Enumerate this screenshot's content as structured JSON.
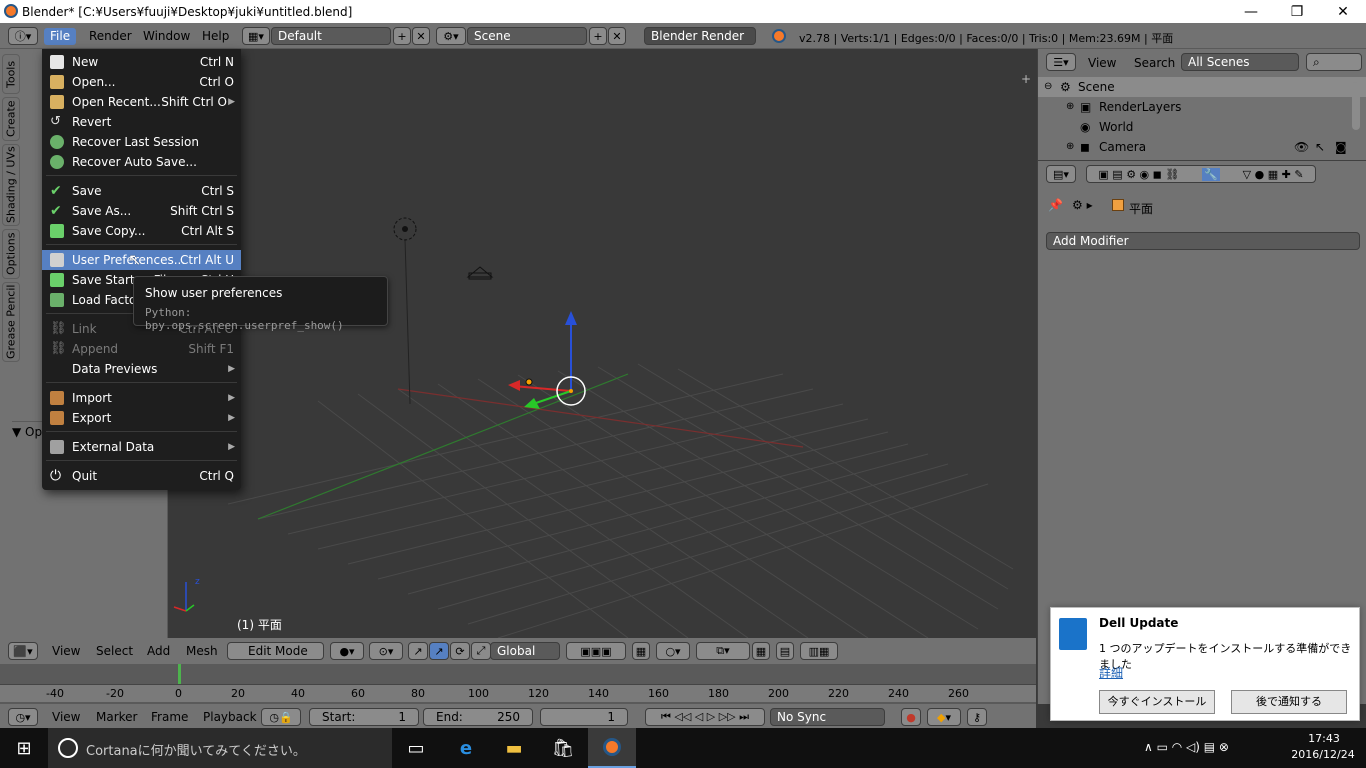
{
  "window": {
    "title": "Blender* [C:¥Users¥fuuji¥Desktop¥juki¥untitled.blend]",
    "minimize": "—",
    "restore": "❐",
    "close": "✕"
  },
  "infobar": {
    "menus": [
      "File",
      "Render",
      "Window",
      "Help"
    ],
    "screen_layout": "Default",
    "scene": "Scene",
    "engine": "Blender Render",
    "stats": "v2.78 | Verts:1/1 | Edges:0/0 | Faces:0/0 | Tris:0 | Mem:23.69M | 平面"
  },
  "tool_tabs": [
    "Tools",
    "Create",
    "Shading / UVs",
    "Options",
    "Grease Pencil"
  ],
  "tool_panel": {
    "operator_label": "Op"
  },
  "file_menu": {
    "items": [
      {
        "label": "New",
        "shortcut": "Ctrl N"
      },
      {
        "label": "Open...",
        "shortcut": "Ctrl O"
      },
      {
        "label": "Open Recent...",
        "shortcut": "Shift Ctrl O"
      },
      {
        "label": "Revert",
        "shortcut": ""
      },
      {
        "label": "Recover Last Session",
        "shortcut": ""
      },
      {
        "label": "Recover Auto Save...",
        "shortcut": ""
      },
      {
        "label": "Save",
        "shortcut": "Ctrl S"
      },
      {
        "label": "Save As...",
        "shortcut": "Shift Ctrl S"
      },
      {
        "label": "Save Copy...",
        "shortcut": "Ctrl Alt S"
      },
      {
        "label": "User Preferences...",
        "shortcut": "Ctrl Alt U"
      },
      {
        "label": "Save Startup File",
        "shortcut": "Ctrl U"
      },
      {
        "label": "Load Factory Settings",
        "shortcut": ""
      },
      {
        "label": "Link",
        "shortcut": "Ctrl Alt O"
      },
      {
        "label": "Append",
        "shortcut": "Shift F1"
      },
      {
        "label": "Data Previews",
        "shortcut": ""
      },
      {
        "label": "Import",
        "shortcut": ""
      },
      {
        "label": "Export",
        "shortcut": ""
      },
      {
        "label": "External Data",
        "shortcut": ""
      },
      {
        "label": "Quit",
        "shortcut": "Ctrl Q"
      }
    ]
  },
  "tooltip": {
    "title": "Show user preferences",
    "python": "Python: bpy.ops.screen.userpref_show()"
  },
  "viewport": {
    "object_label": "(1) 平面"
  },
  "view3d_header": {
    "menus": [
      "View",
      "Select",
      "Add",
      "Mesh"
    ],
    "mode": "Edit Mode",
    "orientation": "Global"
  },
  "timeline": {
    "ticks": [
      "-40",
      "-20",
      "0",
      "20",
      "40",
      "60",
      "80",
      "100",
      "120",
      "140",
      "160",
      "180",
      "200",
      "220",
      "240",
      "260"
    ],
    "menus": [
      "View",
      "Marker",
      "Frame",
      "Playback"
    ],
    "start_label": "Start:",
    "start_value": "1",
    "end_label": "End:",
    "end_value": "250",
    "current": "1",
    "sync": "No Sync"
  },
  "outliner": {
    "menus": [
      "View",
      "Search"
    ],
    "filter": "All Scenes",
    "rows": [
      "Scene",
      "RenderLayers",
      "World",
      "Camera"
    ]
  },
  "properties": {
    "context_object": "平面",
    "add_modifier": "Add Modifier"
  },
  "notification": {
    "app": "Dell Update",
    "message": "1 つのアップデートをインストールする準備ができました",
    "link": "詳細",
    "install_button": "今すぐインストール",
    "later_button": "後で通知する"
  },
  "taskbar": {
    "search_placeholder": "Cortanaに何か聞いてみてください。",
    "time": "17:43",
    "date": "2016/12/24"
  }
}
